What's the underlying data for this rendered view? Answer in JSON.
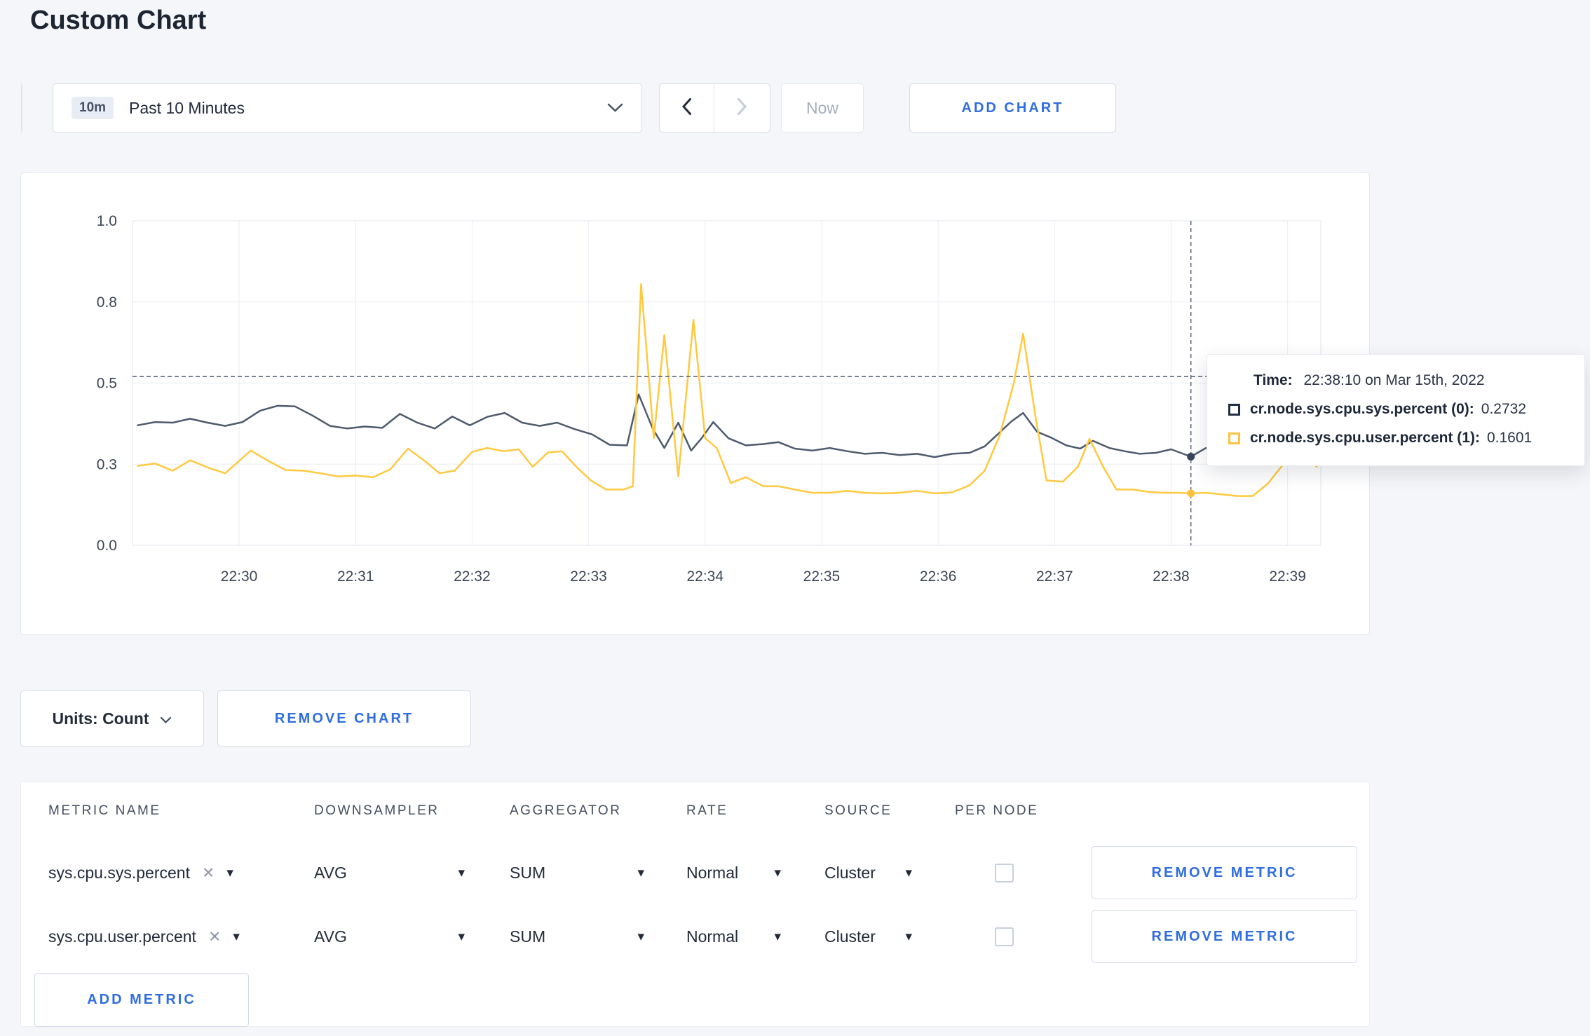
{
  "page": {
    "title": "Custom Chart"
  },
  "colors": {
    "accent": "#2f6de0",
    "page_bg": "#f5f6f9",
    "series_sys": "#4e5a6e",
    "series_user": "#ffc940"
  },
  "icons": {
    "chevron_down": "⌄",
    "chevron_left": "‹",
    "chevron_right": "›",
    "caret_down": "▾",
    "close_x": "×"
  },
  "toolbar": {
    "time_badge": "10m",
    "time_label": "Past 10 Minutes",
    "now_label": "Now",
    "add_chart_label": "ADD CHART"
  },
  "units": {
    "units_label": "Units: Count",
    "remove_chart_label": "REMOVE CHART"
  },
  "tooltip": {
    "time_label": "Time:",
    "time_value": "22:38:10 on Mar 15th, 2022",
    "series": [
      {
        "name": "cr.node.sys.cpu.sys.percent (0):",
        "value": "0.2732",
        "color": "#222e44"
      },
      {
        "name": "cr.node.sys.cpu.user.percent (1):",
        "value": "0.1601",
        "color": "#ffc33d"
      }
    ]
  },
  "metrics_table": {
    "headers": [
      "METRIC NAME",
      "DOWNSAMPLER",
      "AGGREGATOR",
      "RATE",
      "SOURCE",
      "PER NODE"
    ],
    "rows": [
      {
        "metric": "sys.cpu.sys.percent",
        "downsampler": "AVG",
        "aggregator": "SUM",
        "rate": "Normal",
        "source": "Cluster",
        "per_node": false,
        "remove_label": "REMOVE METRIC"
      },
      {
        "metric": "sys.cpu.user.percent",
        "downsampler": "AVG",
        "aggregator": "SUM",
        "rate": "Normal",
        "source": "Cluster",
        "per_node": false,
        "remove_label": "REMOVE METRIC"
      }
    ],
    "add_metric_label": "ADD METRIC"
  },
  "chart_data": {
    "type": "line",
    "title": "",
    "xlabel": "",
    "ylabel": "",
    "grid": true,
    "legend": "tooltip-only",
    "x_range": [
      -0.915,
      9.285
    ],
    "y_range": [
      0,
      1.0
    ],
    "x_ticks": {
      "values": [
        0,
        1,
        2,
        3,
        4,
        5,
        6,
        7,
        8,
        9
      ],
      "labels": [
        "22:30",
        "22:31",
        "22:32",
        "22:33",
        "22:34",
        "22:35",
        "22:36",
        "22:37",
        "22:38",
        "22:39"
      ]
    },
    "y_ticks": {
      "values": [
        0,
        0.25,
        0.5,
        0.75,
        1.0
      ],
      "labels": [
        "0.0",
        "0.3",
        "0.5",
        "0.8",
        "1.0"
      ]
    },
    "series": [
      {
        "name": "cr.node.sys.cpu.sys.percent",
        "color": "#4e5a6e",
        "points": [
          [
            -0.87,
            0.37
          ],
          [
            -0.72,
            0.38
          ],
          [
            -0.57,
            0.378
          ],
          [
            -0.42,
            0.39
          ],
          [
            -0.27,
            0.378
          ],
          [
            -0.12,
            0.368
          ],
          [
            0.03,
            0.38
          ],
          [
            0.18,
            0.415
          ],
          [
            0.33,
            0.43
          ],
          [
            0.48,
            0.428
          ],
          [
            0.63,
            0.4
          ],
          [
            0.78,
            0.368
          ],
          [
            0.93,
            0.36
          ],
          [
            1.08,
            0.366
          ],
          [
            1.23,
            0.362
          ],
          [
            1.38,
            0.405
          ],
          [
            1.53,
            0.378
          ],
          [
            1.68,
            0.36
          ],
          [
            1.83,
            0.397
          ],
          [
            1.98,
            0.37
          ],
          [
            2.13,
            0.396
          ],
          [
            2.28,
            0.408
          ],
          [
            2.43,
            0.378
          ],
          [
            2.58,
            0.368
          ],
          [
            2.73,
            0.378
          ],
          [
            2.88,
            0.358
          ],
          [
            3.03,
            0.342
          ],
          [
            3.18,
            0.31
          ],
          [
            3.33,
            0.308
          ],
          [
            3.43,
            0.465
          ],
          [
            3.55,
            0.36
          ],
          [
            3.65,
            0.3
          ],
          [
            3.77,
            0.378
          ],
          [
            3.88,
            0.292
          ],
          [
            3.97,
            0.33
          ],
          [
            4.07,
            0.38
          ],
          [
            4.2,
            0.33
          ],
          [
            4.35,
            0.308
          ],
          [
            4.5,
            0.312
          ],
          [
            4.63,
            0.318
          ],
          [
            4.77,
            0.298
          ],
          [
            4.92,
            0.292
          ],
          [
            5.07,
            0.3
          ],
          [
            5.22,
            0.29
          ],
          [
            5.37,
            0.282
          ],
          [
            5.52,
            0.285
          ],
          [
            5.67,
            0.278
          ],
          [
            5.82,
            0.282
          ],
          [
            5.97,
            0.272
          ],
          [
            6.12,
            0.282
          ],
          [
            6.27,
            0.285
          ],
          [
            6.4,
            0.305
          ],
          [
            6.52,
            0.345
          ],
          [
            6.63,
            0.382
          ],
          [
            6.73,
            0.408
          ],
          [
            6.85,
            0.35
          ],
          [
            6.97,
            0.332
          ],
          [
            7.1,
            0.308
          ],
          [
            7.22,
            0.298
          ],
          [
            7.33,
            0.322
          ],
          [
            7.47,
            0.3
          ],
          [
            7.6,
            0.29
          ],
          [
            7.73,
            0.282
          ],
          [
            7.87,
            0.285
          ],
          [
            8.0,
            0.296
          ],
          [
            8.17,
            0.2732
          ],
          [
            8.3,
            0.3
          ],
          [
            8.43,
            0.293
          ],
          [
            8.57,
            0.3
          ],
          [
            8.7,
            0.31
          ],
          [
            8.83,
            0.3
          ],
          [
            8.97,
            0.295
          ],
          [
            9.1,
            0.3
          ],
          [
            9.25,
            0.307
          ]
        ]
      },
      {
        "name": "cr.node.sys.cpu.user.percent",
        "color": "#ffc940",
        "points": [
          [
            -0.87,
            0.245
          ],
          [
            -0.72,
            0.252
          ],
          [
            -0.57,
            0.23
          ],
          [
            -0.42,
            0.262
          ],
          [
            -0.27,
            0.24
          ],
          [
            -0.12,
            0.222
          ],
          [
            0.0,
            0.26
          ],
          [
            0.1,
            0.292
          ],
          [
            0.25,
            0.26
          ],
          [
            0.4,
            0.232
          ],
          [
            0.55,
            0.23
          ],
          [
            0.7,
            0.222
          ],
          [
            0.85,
            0.212
          ],
          [
            1.0,
            0.215
          ],
          [
            1.15,
            0.21
          ],
          [
            1.3,
            0.235
          ],
          [
            1.45,
            0.298
          ],
          [
            1.6,
            0.258
          ],
          [
            1.72,
            0.222
          ],
          [
            1.85,
            0.23
          ],
          [
            2.0,
            0.288
          ],
          [
            2.13,
            0.3
          ],
          [
            2.27,
            0.29
          ],
          [
            2.4,
            0.296
          ],
          [
            2.52,
            0.242
          ],
          [
            2.65,
            0.286
          ],
          [
            2.77,
            0.29
          ],
          [
            2.9,
            0.24
          ],
          [
            3.02,
            0.2
          ],
          [
            3.15,
            0.172
          ],
          [
            3.3,
            0.172
          ],
          [
            3.38,
            0.182
          ],
          [
            3.45,
            0.805
          ],
          [
            3.56,
            0.33
          ],
          [
            3.65,
            0.648
          ],
          [
            3.77,
            0.212
          ],
          [
            3.9,
            0.695
          ],
          [
            4.0,
            0.33
          ],
          [
            4.1,
            0.3
          ],
          [
            4.22,
            0.192
          ],
          [
            4.35,
            0.21
          ],
          [
            4.5,
            0.182
          ],
          [
            4.63,
            0.182
          ],
          [
            4.77,
            0.172
          ],
          [
            4.92,
            0.162
          ],
          [
            5.07,
            0.162
          ],
          [
            5.22,
            0.168
          ],
          [
            5.37,
            0.162
          ],
          [
            5.52,
            0.16
          ],
          [
            5.67,
            0.162
          ],
          [
            5.82,
            0.168
          ],
          [
            5.97,
            0.16
          ],
          [
            6.12,
            0.163
          ],
          [
            6.27,
            0.185
          ],
          [
            6.4,
            0.23
          ],
          [
            6.53,
            0.34
          ],
          [
            6.65,
            0.5
          ],
          [
            6.73,
            0.652
          ],
          [
            6.83,
            0.41
          ],
          [
            6.93,
            0.2
          ],
          [
            7.07,
            0.196
          ],
          [
            7.2,
            0.242
          ],
          [
            7.3,
            0.328
          ],
          [
            7.42,
            0.24
          ],
          [
            7.53,
            0.172
          ],
          [
            7.67,
            0.172
          ],
          [
            7.8,
            0.165
          ],
          [
            7.93,
            0.162
          ],
          [
            8.07,
            0.162
          ],
          [
            8.17,
            0.1601
          ],
          [
            8.3,
            0.162
          ],
          [
            8.43,
            0.157
          ],
          [
            8.57,
            0.152
          ],
          [
            8.7,
            0.152
          ],
          [
            8.83,
            0.19
          ],
          [
            8.97,
            0.253
          ],
          [
            9.1,
            0.29
          ],
          [
            9.25,
            0.242
          ]
        ]
      }
    ],
    "crosshair": {
      "x": 8.17,
      "hline_y": 0.52,
      "markers": [
        {
          "value": 0.2732,
          "color": "#39455c"
        },
        {
          "value": 0.1601,
          "color": "#ffc33d"
        }
      ]
    }
  }
}
